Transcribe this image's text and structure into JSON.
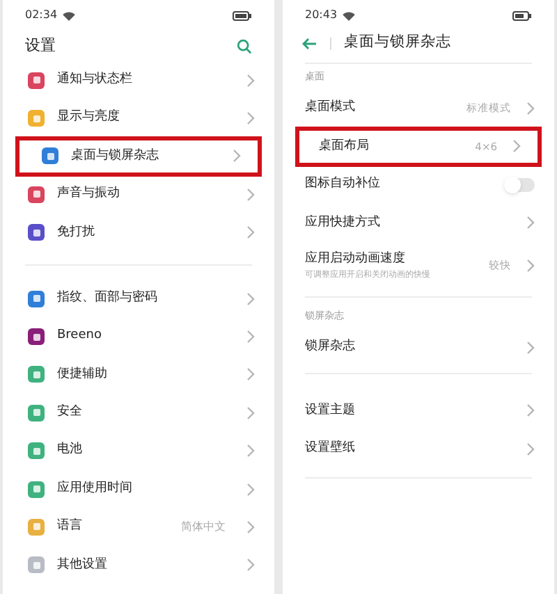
{
  "left_screen": {
    "status_bar": {
      "time": "02:34"
    },
    "title": "设置",
    "groups": [
      [
        {
          "label": "通知与状态栏",
          "color": "#d9455f",
          "highlighted": false
        },
        {
          "label": "显示与亮度",
          "color": "#f0b030",
          "highlighted": false
        },
        {
          "label": "桌面与锁屏杂志",
          "color": "#2f7fd8",
          "highlighted": true
        },
        {
          "label": "声音与振动",
          "color": "#d9455f",
          "highlighted": false
        },
        {
          "label": "免打扰",
          "color": "#5a4fc9",
          "highlighted": false
        }
      ],
      [
        {
          "label": "指纹、面部与密码",
          "color": "#2f7fd8",
          "highlighted": false
        },
        {
          "label": "Breeno",
          "color": "#8a1f7a",
          "highlighted": false
        },
        {
          "label": "便捷辅助",
          "color": "#3fb27f",
          "highlighted": false
        },
        {
          "label": "安全",
          "color": "#3fb27f",
          "highlighted": false
        },
        {
          "label": "电池",
          "color": "#3fb27f",
          "highlighted": false
        },
        {
          "label": "应用使用时间",
          "color": "#3fb27f",
          "highlighted": false
        },
        {
          "label": "语言",
          "color": "#e8b040",
          "highlighted": false,
          "value": "简体中文"
        },
        {
          "label": "其他设置",
          "color": "#b8bcc4",
          "highlighted": false
        }
      ]
    ]
  },
  "right_screen": {
    "status_bar": {
      "time": "20:43"
    },
    "title": "桌面与锁屏杂志",
    "sections": [
      {
        "header": "桌面",
        "rows": [
          {
            "kind": "link",
            "label": "桌面模式",
            "value": "标准模式",
            "highlighted": false
          },
          {
            "kind": "link",
            "label": "桌面布局",
            "value": "4×6",
            "highlighted": true
          },
          {
            "kind": "switch",
            "label": "图标自动补位",
            "on": false,
            "highlighted": false
          },
          {
            "kind": "link",
            "label": "应用快捷方式",
            "highlighted": false
          },
          {
            "kind": "link",
            "label": "应用启动动画速度",
            "subtitle": "可调整应用开启和关闭动画的快慢",
            "value": "较快",
            "highlighted": false
          }
        ]
      },
      {
        "header": "锁屏杂志",
        "rows": [
          {
            "kind": "link",
            "label": "锁屏杂志",
            "highlighted": false
          }
        ]
      },
      {
        "rows": [
          {
            "kind": "link",
            "label": "设置主题",
            "highlighted": false
          },
          {
            "kind": "link",
            "label": "设置壁纸",
            "highlighted": false
          }
        ]
      }
    ]
  }
}
